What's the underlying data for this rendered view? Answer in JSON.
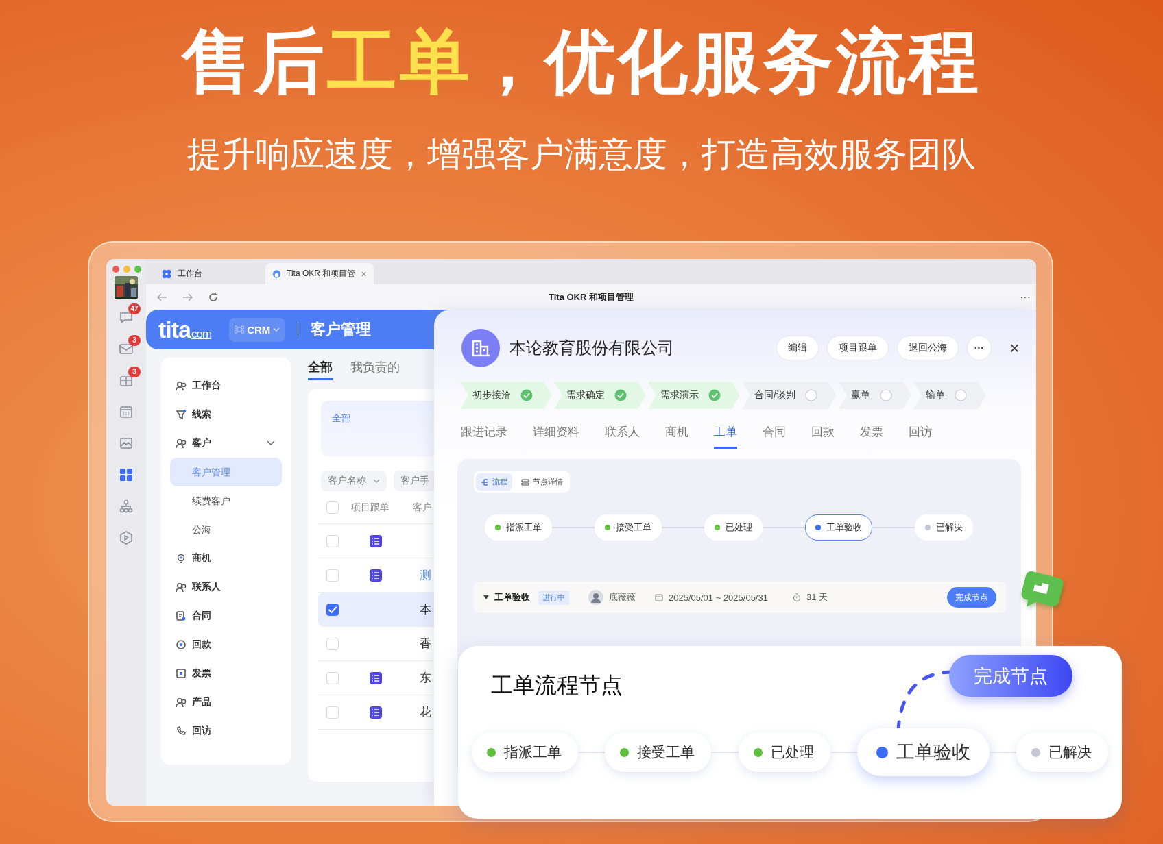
{
  "headline": [
    {
      "text": "售后",
      "highlight": false
    },
    {
      "text": "工单",
      "highlight": true
    },
    {
      "text": "，优化服务流程",
      "highlight": false
    }
  ],
  "subheadline": "提升响应速度，增强客户满意度，打造高效服务团队",
  "browser": {
    "tabs": [
      {
        "label": "工作台",
        "selected": false
      },
      {
        "label": "Tita OKR 和项目管",
        "selected": true,
        "close": "×"
      }
    ],
    "title": "Tita OKR 和项目管理",
    "more": "···"
  },
  "dock": {
    "items": [
      {
        "badge": "47",
        "selected": false
      },
      {
        "badge": "3",
        "selected": false
      },
      {
        "badge": "3",
        "selected": false
      },
      {
        "selected": false
      },
      {
        "selected": false
      },
      {
        "selected": true
      },
      {
        "selected": false
      },
      {
        "selected": false
      }
    ]
  },
  "app_header": {
    "logo": "tita",
    "logo_suffix": "com",
    "module": "CRM",
    "title": "客户管理"
  },
  "nav": {
    "items": [
      {
        "label": "工作台",
        "selected": false
      },
      {
        "label": "线索",
        "selected": false
      },
      {
        "label": "客户",
        "selected": false,
        "expanded": true,
        "children": [
          {
            "label": "客户管理",
            "selected": true
          },
          {
            "label": "续费客户",
            "selected": false
          },
          {
            "label": "公海",
            "selected": false
          }
        ]
      },
      {
        "label": "商机",
        "selected": false
      },
      {
        "label": "联系人",
        "selected": false
      },
      {
        "label": "合同",
        "selected": false
      },
      {
        "label": "回款",
        "selected": false
      },
      {
        "label": "发票",
        "selected": false
      },
      {
        "label": "产品",
        "selected": false
      },
      {
        "label": "回访",
        "selected": false
      }
    ]
  },
  "list": {
    "tabs": [
      {
        "label": "全部",
        "selected": true
      },
      {
        "label": "我负责的",
        "selected": false
      }
    ],
    "view_card": {
      "label": "全部"
    },
    "filters": [
      {
        "label": "客户名称"
      },
      {
        "label": "客户手"
      }
    ],
    "columns": [
      "项目跟单",
      "客户"
    ],
    "select_all_checked": false,
    "rows": [
      {
        "checked": false,
        "has_doc": true
      },
      {
        "checked": false,
        "has_doc": true,
        "name": "测",
        "link": true
      },
      {
        "checked": true,
        "has_doc": false,
        "name": "本",
        "link": false
      },
      {
        "checked": false,
        "has_doc": false,
        "name": "香",
        "link": false
      },
      {
        "checked": false,
        "has_doc": true,
        "name": "东",
        "link": false
      },
      {
        "checked": false,
        "has_doc": true,
        "name": "花",
        "link": false
      }
    ]
  },
  "detail": {
    "company": "本论教育股份有限公司",
    "actions": [
      "编辑",
      "项目跟单",
      "退回公海"
    ],
    "more": "···",
    "close": "×",
    "stages": [
      {
        "label": "初步接洽",
        "done": true
      },
      {
        "label": "需求确定",
        "done": true
      },
      {
        "label": "需求演示",
        "done": true
      },
      {
        "label": "合同/谈判",
        "done": false
      },
      {
        "label": "赢单",
        "done": false
      },
      {
        "label": "输单",
        "done": false
      }
    ],
    "tabs": [
      {
        "label": "跟进记录",
        "selected": false
      },
      {
        "label": "详细资料",
        "selected": false
      },
      {
        "label": "联系人",
        "selected": false
      },
      {
        "label": "商机",
        "selected": false
      },
      {
        "label": "工单",
        "selected": true
      },
      {
        "label": "合同",
        "selected": false
      },
      {
        "label": "回款",
        "selected": false
      },
      {
        "label": "发票",
        "selected": false
      },
      {
        "label": "回访",
        "selected": false
      }
    ],
    "flow": {
      "views": [
        {
          "label": "流程",
          "selected": true
        },
        {
          "label": "节点详情",
          "selected": false
        }
      ],
      "nodes": [
        {
          "label": "指派工单",
          "color": "#5fbf3a",
          "selected": false
        },
        {
          "label": "接受工单",
          "color": "#5fbf3a",
          "selected": false
        },
        {
          "label": "已处理",
          "color": "#5fbf3a",
          "selected": false
        },
        {
          "label": "工单验收",
          "color": "#3b6cf6",
          "selected": true
        },
        {
          "label": "已解决",
          "color": "#c3c8d4",
          "selected": false
        }
      ],
      "node_bar": {
        "title": "工单验收",
        "status": "进行中",
        "owner": "底薇薇",
        "dates": "2025/05/01 ~ 2025/05/31",
        "duration": "31 天",
        "button": "完成节点"
      }
    }
  },
  "callout": {
    "title": "工单流程节点",
    "button": "完成节点",
    "nodes": [
      {
        "label": "指派工单",
        "color": "#5fbf3a",
        "selected": false
      },
      {
        "label": "接受工单",
        "color": "#5fbf3a",
        "selected": false
      },
      {
        "label": "已处理",
        "color": "#5fbf3a",
        "selected": false
      },
      {
        "label": "工单验收",
        "color": "#3b6cf6",
        "selected": true
      },
      {
        "label": "已解决",
        "color": "#c3c8d4",
        "selected": false
      }
    ]
  }
}
